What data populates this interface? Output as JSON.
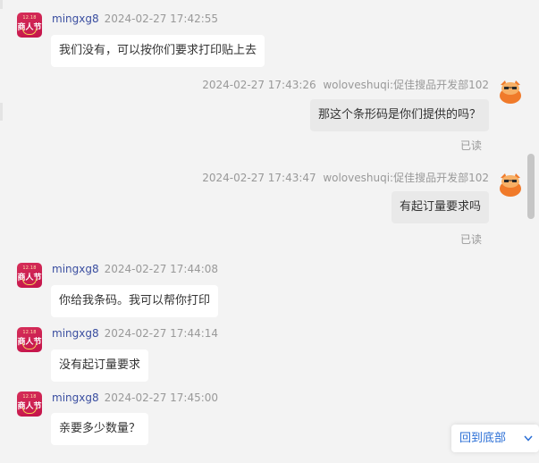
{
  "messages": [
    {
      "side": "left",
      "user": "mingxg8",
      "time": "2024-02-27 17:42:55",
      "text": "我们没有，可以按你们要求打印贴上去"
    },
    {
      "side": "right",
      "user": "woloveshuqi:促佳搜品开发部102",
      "time": "2024-02-27 17:43:26",
      "text": "那这个条形码是你们提供的吗？",
      "status": "已读"
    },
    {
      "side": "right",
      "user": "woloveshuqi:促佳搜品开发部102",
      "time": "2024-02-27 17:43:47",
      "text": "有起订量要求吗",
      "status": "已读"
    },
    {
      "side": "left",
      "user": "mingxg8",
      "time": "2024-02-27 17:44:08",
      "text": "你给我条码。我可以帮你打印"
    },
    {
      "side": "left",
      "user": "mingxg8",
      "time": "2024-02-27 17:44:14",
      "text": "没有起订量要求"
    },
    {
      "side": "left",
      "user": "mingxg8",
      "time": "2024-02-27 17:45:00",
      "text": "亲要多少数量？"
    }
  ],
  "avatar_left": {
    "top_text": "12.18",
    "main_text": "商人节",
    "color": "#c4134a"
  },
  "back_to_bottom": {
    "label": "回到底部",
    "icon": "chevron-down-icon"
  },
  "colors": {
    "username": "#3a4ea0",
    "link": "#2b6fd6",
    "background": "#f3f3f3"
  }
}
